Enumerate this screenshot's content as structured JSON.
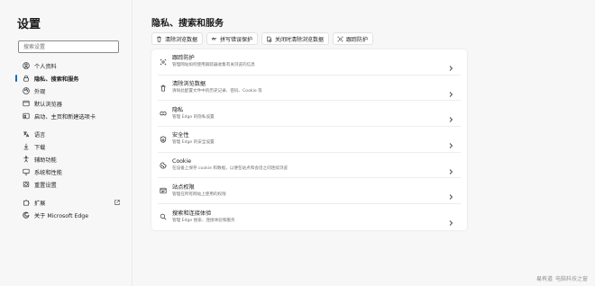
{
  "sidebar": {
    "title": "设置",
    "search_placeholder": "搜索设置",
    "items": [
      {
        "label": "个人资料",
        "icon": "profile-icon"
      },
      {
        "label": "隐私、搜索和服务",
        "icon": "lock-icon",
        "active": true
      },
      {
        "label": "外观",
        "icon": "appearance-icon"
      },
      {
        "label": "默认浏览器",
        "icon": "browser-icon"
      },
      {
        "label": "启动、主页和新建选项卡",
        "icon": "home-icon"
      },
      {
        "label": "语言",
        "icon": "language-icon"
      },
      {
        "label": "下载",
        "icon": "download-icon"
      },
      {
        "label": "辅助功能",
        "icon": "accessibility-icon"
      },
      {
        "label": "系统和性能",
        "icon": "system-icon"
      },
      {
        "label": "重置设置",
        "icon": "reset-icon"
      },
      {
        "label": "扩展",
        "icon": "puzzle-icon"
      },
      {
        "label": "关于 Microsoft Edge",
        "icon": "edge-icon"
      }
    ]
  },
  "main": {
    "title": "隐私、搜索和服务",
    "quick_actions": [
      {
        "label": "清除浏览数据",
        "icon": "trash-icon"
      },
      {
        "label": "拼写错误保护",
        "icon": "typo-icon"
      },
      {
        "label": "关闭时清除浏览数据",
        "icon": "clear-on-close-icon"
      },
      {
        "label": "跟踪防护",
        "icon": "tracking-icon"
      }
    ],
    "rows": [
      {
        "title": "跟踪防护",
        "desc": "管理网站如何使用跟踪器收集有关浏览的信息",
        "icon": "tracking-icon"
      },
      {
        "title": "清除浏览数据",
        "desc": "清除此配置文件中的历史记录、密码、Cookie 等",
        "icon": "trash-icon"
      },
      {
        "title": "隐私",
        "desc": "管理 Edge 的隐私设置",
        "icon": "privacy-icon"
      },
      {
        "title": "安全性",
        "desc": "管理 Edge 的安全设置",
        "icon": "shield-icon"
      },
      {
        "title": "Cookie",
        "desc": "在设备上保存 cookie 和数据，以便在站点和会话之间连续浏览",
        "icon": "cookie-icon"
      },
      {
        "title": "站点权限",
        "desc": "管理在所有网站上使用的权限",
        "icon": "site-permissions-icon"
      },
      {
        "title": "搜索和连接体验",
        "desc": "管理 Edge 搜索、连接体验和服务",
        "icon": "search-icon"
      }
    ]
  },
  "watermark": {
    "brand": "易有道",
    "text": "电脑科技之窗"
  },
  "colors": {
    "accent": "#0f6cbd",
    "background": "#f7f7f7",
    "card": "#ffffff"
  }
}
